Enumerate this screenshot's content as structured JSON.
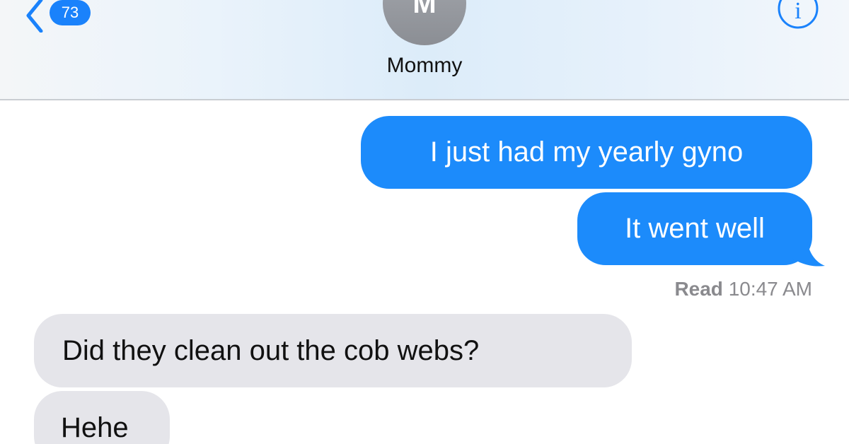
{
  "header": {
    "back_badge": "73",
    "avatar_initial": "M",
    "contact_name": "Mommy",
    "icons": {
      "back": "chevron-left-icon",
      "info": "info-icon"
    }
  },
  "messages": [
    {
      "direction": "sent",
      "text": "I just had my yearly gyno"
    },
    {
      "direction": "sent",
      "text": "It went well"
    },
    {
      "direction": "received",
      "text": "Did they clean out the cob webs?"
    },
    {
      "direction": "received",
      "text": "Hehe"
    }
  ],
  "receipt": {
    "label": "Read",
    "time": "10:47 AM"
  },
  "colors": {
    "accent": "#1a82fb",
    "sent_bubble": "#1c8bfb",
    "received_bubble": "#e5e5ea",
    "avatar": "#97999f",
    "receipt_text": "#8a8a8e"
  }
}
